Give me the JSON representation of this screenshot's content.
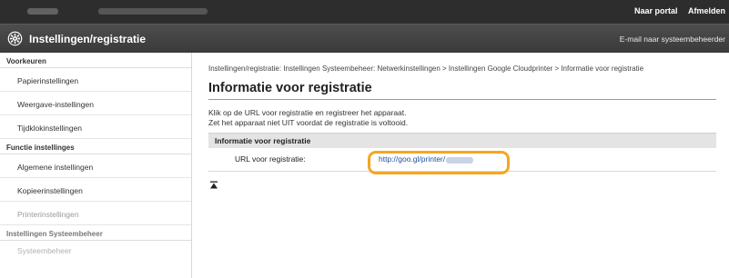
{
  "topbar": {
    "links": [
      "Naar portal",
      "Afmelden"
    ]
  },
  "header": {
    "title": "Instellingen/registratie",
    "email_link": "E-mail naar systeembeheerder"
  },
  "sidebar": {
    "sections": [
      {
        "label": "Voorkeuren",
        "items": [
          "Papierinstellingen",
          "Weergave-instellingen",
          "Tijdklokinstellingen"
        ]
      },
      {
        "label": "Functie instellinges",
        "items": [
          "Algemene instellingen",
          "Kopieerinstellingen",
          "Printerinstellingen"
        ]
      },
      {
        "label": "Instellingen Systeembeheer",
        "items": [
          "Systeembeheer"
        ]
      }
    ]
  },
  "main": {
    "breadcrumb": "Instellingen/registratie: Instellingen Systeembeheer: Netwerkinstellingen > Instellingen Google Cloudprinter > Informatie voor registratie",
    "title": "Informatie voor registratie",
    "description": [
      "Klik op de URL voor registratie en registreer het apparaat.",
      "Zet het apparaat niet UIT voordat de registratie is voltooid."
    ],
    "table": {
      "header": "Informatie voor registratie",
      "row_label": "URL voor registratie:",
      "row_value": "http://goo.gl/printer/"
    }
  },
  "colors": {
    "topbar": "#2d2d2d",
    "titlebar": "#444444",
    "link": "#1d4f9e",
    "highlight": "#f5a623"
  }
}
